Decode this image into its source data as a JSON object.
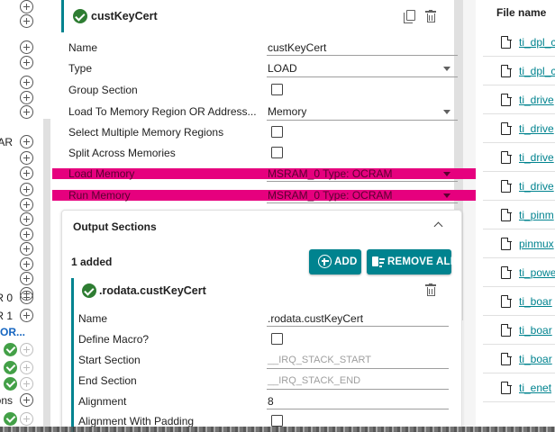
{
  "left_tree": {
    "rows": [
      {
        "text": "",
        "icon": "plus"
      },
      {
        "text": "",
        "icon": "plus"
      },
      {
        "text": "",
        "icon": "plus"
      },
      {
        "text": "",
        "icon": "plus"
      },
      {
        "text": "",
        "icon": "plus"
      },
      {
        "text": "",
        "icon": "plus"
      },
      {
        "text": "",
        "icon": "plus"
      },
      {
        "text": "AR",
        "icon": "plus"
      },
      {
        "text": "",
        "icon": "plus"
      },
      {
        "text": "",
        "icon": "plus"
      },
      {
        "text": "",
        "icon": "plus"
      },
      {
        "text": "",
        "icon": "plus"
      },
      {
        "text": "",
        "icon": "plus"
      },
      {
        "text": "",
        "icon": "plus"
      },
      {
        "text": "",
        "icon": "plus"
      },
      {
        "text": "",
        "icon": "plus"
      },
      {
        "text": "",
        "icon": "plus"
      },
      {
        "text": "",
        "icon": "plus"
      },
      {
        "text": "R 0",
        "icon": "plus"
      },
      {
        "text": "R 1",
        "icon": "plus"
      },
      {
        "text": "OR...",
        "icon": "none"
      },
      {
        "text": "",
        "icon": "check-plus"
      },
      {
        "text": "",
        "icon": "check-plus"
      },
      {
        "text": "",
        "icon": "check-plus"
      },
      {
        "text": "ons",
        "icon": "plus"
      },
      {
        "text": "",
        "icon": "check-plus"
      }
    ]
  },
  "section": {
    "title": "custKeyCert",
    "fields": {
      "name": {
        "label": "Name",
        "value": "custKeyCert"
      },
      "type": {
        "label": "Type",
        "value": "LOAD"
      },
      "group_section": {
        "label": "Group Section",
        "checked": false
      },
      "load_to_memory": {
        "label": "Load To Memory Region OR Address...",
        "value": "Memory"
      },
      "select_multiple": {
        "label": "Select Multiple Memory Regions",
        "checked": false
      },
      "split_across": {
        "label": "Split Across Memories",
        "checked": false
      },
      "load_memory": {
        "label": "Load Memory",
        "value": "MSRAM_0 Type: OCRAM"
      },
      "run_memory": {
        "label": "Run Memory",
        "value": "MSRAM_0 Type: OCRAM"
      }
    }
  },
  "output_sections": {
    "title": "Output Sections",
    "count_text": "1 added",
    "add_label": "ADD",
    "remove_all_label": "REMOVE ALL",
    "item": {
      "title": ".rodata.custKeyCert",
      "fields": {
        "name": {
          "label": "Name",
          "value": ".rodata.custKeyCert"
        },
        "define_macro": {
          "label": "Define Macro?",
          "checked": false
        },
        "start_section": {
          "label": "Start Section",
          "placeholder": "__IRQ_STACK_START"
        },
        "end_section": {
          "label": "End Section",
          "placeholder": "__IRQ_STACK_END"
        },
        "alignment": {
          "label": "Alignment",
          "value": "8"
        },
        "alignment_padding": {
          "label": "Alignment With Padding",
          "checked": false
        }
      }
    }
  },
  "files": {
    "header": "File name",
    "items": [
      "ti_dpl_c",
      "ti_dpl_c",
      "ti_drive",
      "ti_drive",
      "ti_drive",
      "ti_drive",
      "ti_pinm",
      "pinmux",
      "ti_powe",
      "ti_boar",
      "ti_boar",
      "ti_boar",
      "ti_enet"
    ]
  },
  "colors": {
    "accent": "#00838f",
    "check": "#2e7d32",
    "highlight": "#e6007e",
    "link": "#00838f"
  }
}
